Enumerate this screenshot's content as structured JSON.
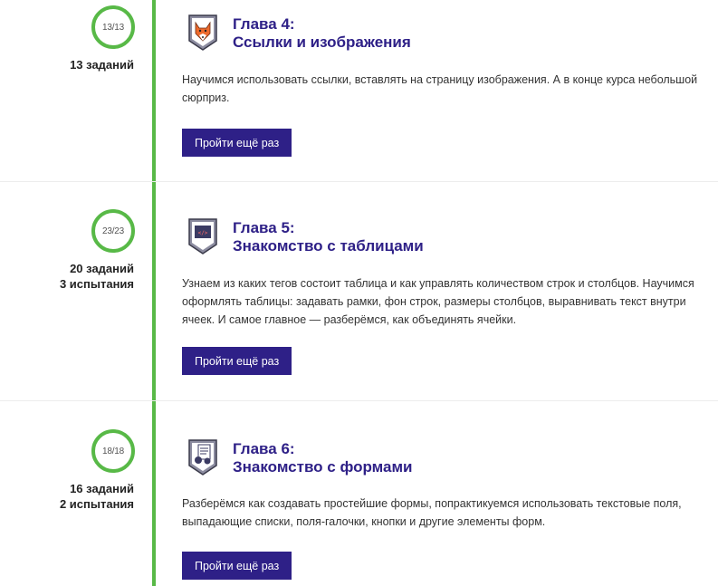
{
  "chapters": [
    {
      "progress": "13/13",
      "tasks": "13 заданий",
      "trials": "",
      "icon": "fox-icon",
      "title_line1": "Глава 4:",
      "title_line2": "Ссылки и изображения",
      "description": "Научимся использовать ссылки, вставлять на страницу изображения. А в конце курса небольшой сюрприз.",
      "button": "Пройти ещё раз"
    },
    {
      "progress": "23/23",
      "tasks": "20 заданий",
      "trials": "3 испытания",
      "icon": "code-table-icon",
      "title_line1": "Глава 5:",
      "title_line2": "Знакомство с таблицами",
      "description": "Узнаем из каких тегов состоит таблица и как управлять количеством строк и столбцов. Научимся оформлять таблицы: задавать рамки, фон строк, размеры столбцов, выравнивать текст внутри ячеек. И самое главное — разберёмся, как объединять ячейки.",
      "button": "Пройти ещё раз"
    },
    {
      "progress": "18/18",
      "tasks": "16 заданий",
      "trials": "2 испытания",
      "icon": "form-icon",
      "title_line1": "Глава 6:",
      "title_line2": "Знакомство с формами",
      "description": "Разберёмся как создавать простейшие формы, попрактикуемся использовать текстовые поля, выпадающие списки, поля-галочки, кнопки и другие элементы форм.",
      "button": "Пройти ещё раз"
    }
  ],
  "colors": {
    "accent": "#2e2087",
    "timeline": "#58b947"
  }
}
